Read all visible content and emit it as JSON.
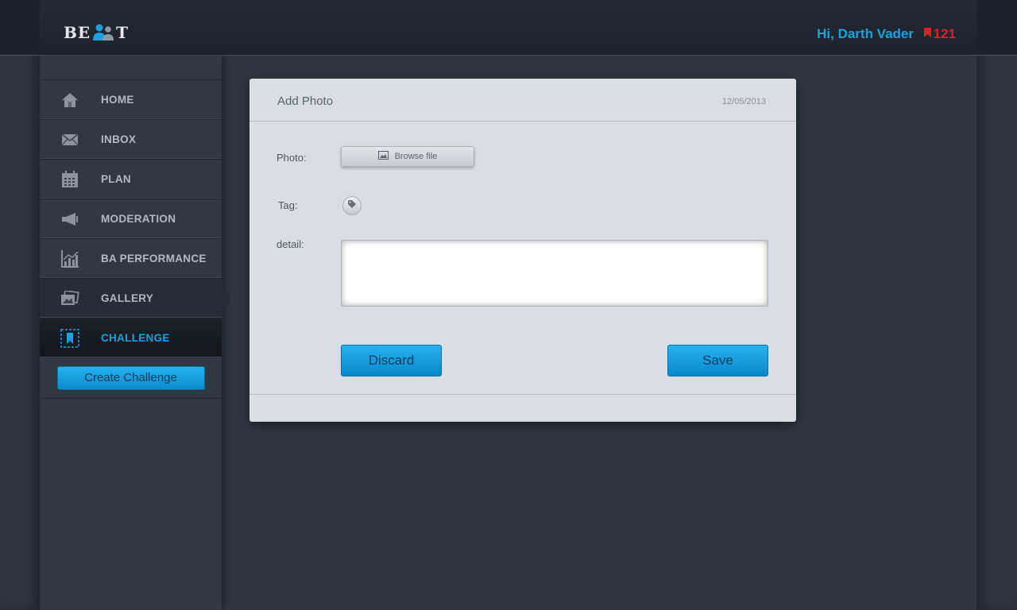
{
  "header": {
    "logo_left": "BE",
    "logo_right": "T",
    "greeting": "Hi, Darth Vader",
    "badge_count": "121"
  },
  "sidebar": {
    "items": [
      {
        "label": "HOME",
        "icon": "home-icon"
      },
      {
        "label": "INBOX",
        "icon": "envelope-icon"
      },
      {
        "label": "PLAN",
        "icon": "calendar-icon"
      },
      {
        "label": "MODERATION",
        "icon": "megaphone-icon"
      },
      {
        "label": "BA PERFORMANCE",
        "icon": "chart-icon"
      },
      {
        "label": "GALLERY",
        "icon": "photos-icon"
      },
      {
        "label": "CHALLENGE",
        "icon": "bookmark-icon",
        "active": true
      }
    ],
    "create_button": "Create Challenge"
  },
  "dialog": {
    "title": "Add Photo",
    "date": "12/05/2013",
    "photo_label": "Photo:",
    "browse_label": "Browse file",
    "tag_label": "Tag:",
    "detail_label": "detail:",
    "detail_value": "",
    "discard_label": "Discard",
    "save_label": "Save"
  },
  "colors": {
    "accent": "#1ba2de",
    "badge": "#e41e26",
    "card_bg": "#d9dde4",
    "sidebar_bg": "#303843"
  }
}
